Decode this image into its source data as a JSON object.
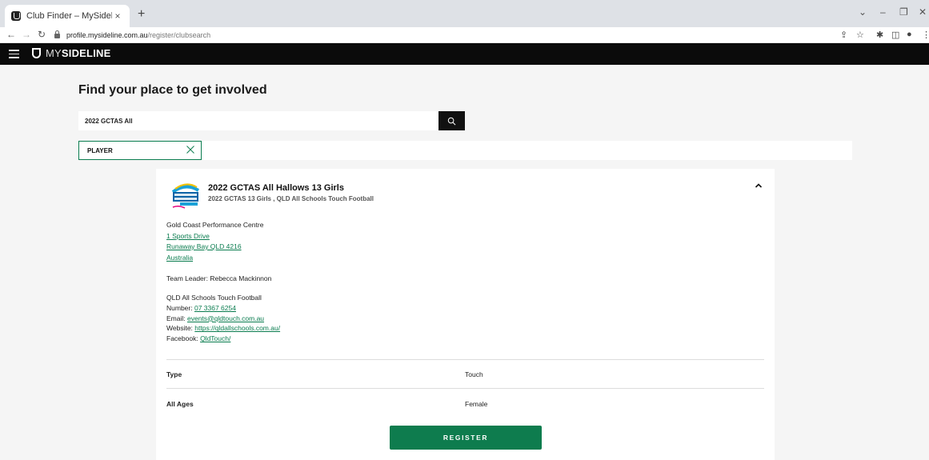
{
  "browser": {
    "tab_title": "Club Finder – MySideline",
    "tab_close": "×",
    "new_tab": "+",
    "url_host": "profile.mysideline.com.au",
    "url_path": "/register/clubsearch"
  },
  "header": {
    "logo_my": "MY",
    "logo_sideline": "SIDELINE"
  },
  "main": {
    "title": "Find your place to get involved",
    "search_value": "2022 GCTAS All",
    "filter_chip": "PLAYER"
  },
  "club": {
    "name": "2022 GCTAS All Hallows 13 Girls",
    "subtitle": "2022 GCTAS 13 Girls , QLD All Schools Touch Football",
    "venue_name": "Gold Coast Performance Centre",
    "address_line1": "1 Sports Drive",
    "address_line2": "Runaway Bay QLD 4216",
    "country": "Australia",
    "team_leader": "Team Leader: Rebecca Mackinnon",
    "org_name": "QLD All Schools Touch Football",
    "number_label": "Number: ",
    "number": "07 3367 6254",
    "email_label": "Email: ",
    "email": "events@qldtouch.com.au",
    "website_label": "Website: ",
    "website": "https://qldallschools.com.au/",
    "facebook_label": "Facebook: ",
    "facebook": "QldTouch/",
    "type_label": "Type",
    "type_value": "Touch",
    "ages_label": "All Ages",
    "gender_value": "Female",
    "register_label": "REGISTER"
  },
  "colors": {
    "brand_green": "#0e7c4e",
    "header_black": "#0b0b0b"
  }
}
